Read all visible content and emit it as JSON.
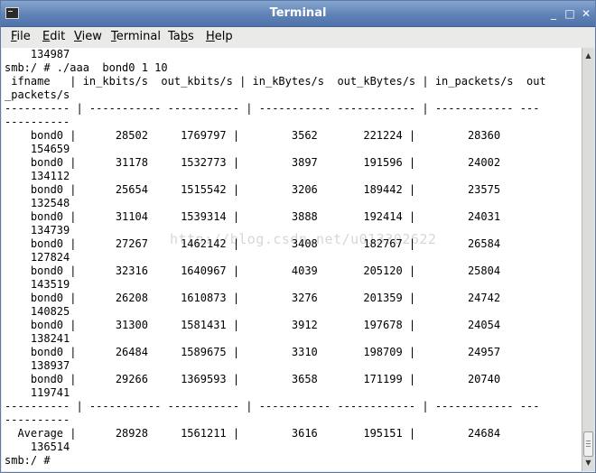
{
  "window": {
    "title": "Terminal"
  },
  "window_controls": {
    "minimize": "_",
    "maximize": "□",
    "close": "✕"
  },
  "menu": {
    "items": [
      {
        "key": "F",
        "rest": "ile"
      },
      {
        "key": "E",
        "rest": "dit"
      },
      {
        "key": "V",
        "rest": "iew"
      },
      {
        "key": "T",
        "rest": "erminal"
      },
      {
        "pre": "Ta",
        "key": "b",
        "rest": "s"
      },
      {
        "key": "H",
        "rest": "elp"
      }
    ]
  },
  "terminal": {
    "watermark": "http://blog.csdn.net/u013302622",
    "lines": [
      "    134987",
      "smb:/ # ./aaa  bond0 1 10",
      " ifname   | in_kbits/s  out_kbits/s | in_kBytes/s  out_kBytes/s | in_packets/s  out",
      "_packets/s",
      "---------- | ----------- ----------- | ----------- ------------ | ------------ ---",
      "----------",
      "    bond0 |      28502     1769797 |        3562       221224 |        28360",
      "    154659",
      "    bond0 |      31178     1532773 |        3897       191596 |        24002",
      "    134112",
      "    bond0 |      25654     1515542 |        3206       189442 |        23575",
      "    132548",
      "    bond0 |      31104     1539314 |        3888       192414 |        24031",
      "    134739",
      "    bond0 |      27267     1462142 |        3408       182767 |        26584",
      "    127824",
      "    bond0 |      32316     1640967 |        4039       205120 |        25804",
      "    143519",
      "    bond0 |      26208     1610873 |        3276       201359 |        24742",
      "    140825",
      "    bond0 |      31300     1581431 |        3912       197678 |        24054",
      "    138241",
      "    bond0 |      26484     1589675 |        3310       198709 |        24957",
      "    138937",
      "    bond0 |      29266     1369593 |        3658       171199 |        20740",
      "    119741",
      "---------- | ----------- ----------- | ----------- ------------ | ------------ ---",
      "----------",
      "  Average |      28928     1561211 |        3616       195151 |        24684",
      "    136514",
      "smb:/ # "
    ]
  }
}
